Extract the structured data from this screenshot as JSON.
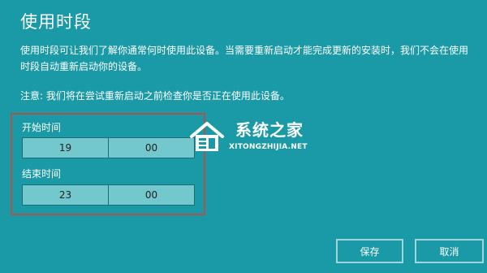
{
  "page": {
    "title": "使用时段",
    "description": "使用时段可让我们了解你通常何时使用此设备。当需要重新启动才能完成更新的安装时，我们不会在使用时段自动重新启动你的设备。",
    "note": "注意: 我们将在尝试重新启动之前检查你是否正在使用此设备。"
  },
  "start_time": {
    "label": "开始时间",
    "hour": "19",
    "minute": "00"
  },
  "end_time": {
    "label": "结束时间",
    "hour": "23",
    "minute": "00"
  },
  "watermark": {
    "title": "系统之家",
    "url": "XITONGZHIJIA.NET"
  },
  "buttons": {
    "save": "保存",
    "cancel": "取消"
  },
  "colors": {
    "background": "#1a9aa6",
    "picker_fill": "#72c8cd",
    "highlight_border": "#b2524f"
  }
}
